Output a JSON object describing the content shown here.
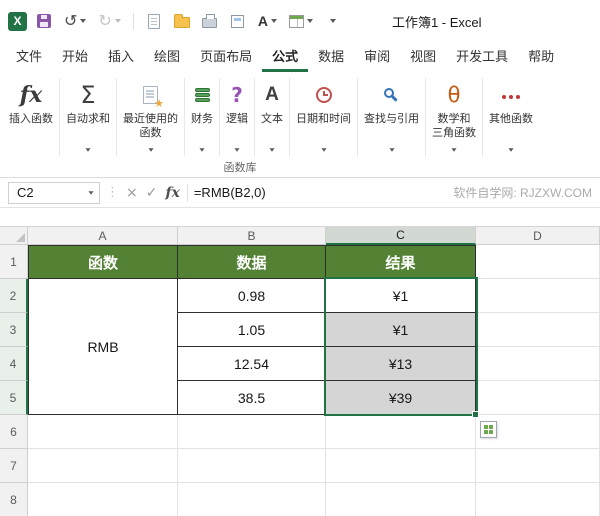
{
  "titlebar": {
    "title": "工作簿1 - Excel"
  },
  "tabs": [
    {
      "label": "文件"
    },
    {
      "label": "开始"
    },
    {
      "label": "插入"
    },
    {
      "label": "绘图"
    },
    {
      "label": "页面布局"
    },
    {
      "label": "公式",
      "active": true
    },
    {
      "label": "数据"
    },
    {
      "label": "审阅"
    },
    {
      "label": "视图"
    },
    {
      "label": "开发工具"
    },
    {
      "label": "帮助"
    }
  ],
  "ribbon": {
    "group_label": "函数库",
    "buttons": [
      {
        "label": "插入函数",
        "icon": "fx-icon"
      },
      {
        "label": "自动求和",
        "icon": "sigma-icon",
        "dropdown": true
      },
      {
        "label": "最近使用的",
        "label2": "函数",
        "icon": "recent-doc-star-icon",
        "dropdown": true
      },
      {
        "label": "财务",
        "icon": "coins-icon",
        "dropdown": true
      },
      {
        "label": "逻辑",
        "icon": "question-mark-icon",
        "dropdown": true
      },
      {
        "label": "文本",
        "icon": "letter-a-icon",
        "dropdown": true
      },
      {
        "label": "日期和时间",
        "icon": "clock-icon",
        "dropdown": true
      },
      {
        "label": "查找与引用",
        "icon": "magnifier-icon",
        "dropdown": true
      },
      {
        "label": "数学和",
        "label2": "三角函数",
        "icon": "theta-icon",
        "dropdown": true
      },
      {
        "label": "其他函数",
        "icon": "dots-icon",
        "dropdown": true
      }
    ]
  },
  "formula_bar": {
    "cell_ref": "C2",
    "formula": "=RMB(B2,0)",
    "watermark": "软件自学网: RJZXW.COM"
  },
  "sheet": {
    "col_headers": [
      "A",
      "B",
      "C",
      "D"
    ],
    "row_headers": [
      "1",
      "2",
      "3",
      "4",
      "5",
      "6",
      "7",
      "8"
    ],
    "selected_range": "C2:C5",
    "table": {
      "headers": [
        "函数",
        "数据",
        "结果"
      ],
      "function_name": "RMB",
      "rows": [
        {
          "data": "0.98",
          "result": "¥1"
        },
        {
          "data": "1.05",
          "result": "¥1"
        },
        {
          "data": "12.54",
          "result": "¥13"
        },
        {
          "data": "38.5",
          "result": "¥39"
        }
      ]
    }
  },
  "colors": {
    "excel_green": "#217346",
    "table_header_green": "#548235",
    "selection_fill": "#D5D5D5"
  }
}
